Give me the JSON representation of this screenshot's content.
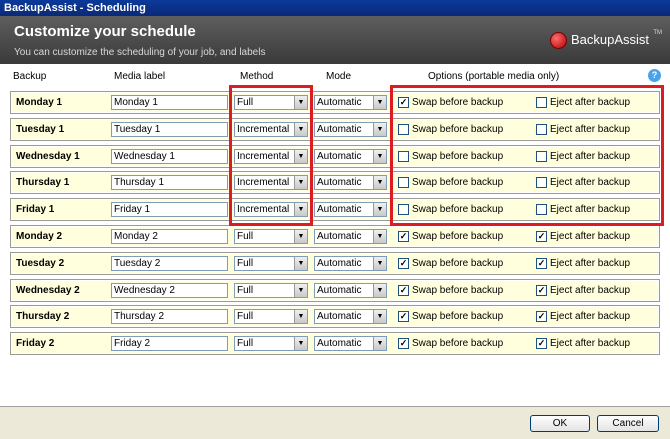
{
  "window": {
    "title": "BackupAssist - Scheduling"
  },
  "banner": {
    "title": "Customize your schedule",
    "subtitle": "You can customize the scheduling of your job, and labels",
    "logo_text": "BackupAssist",
    "logo_tm": "TM"
  },
  "columns": {
    "backup": "Backup",
    "media_label": "Media label",
    "method": "Method",
    "mode": "Mode",
    "options": "Options (portable media only)",
    "help": "?"
  },
  "options_labels": {
    "swap": "Swap before backup",
    "eject": "Eject after backup"
  },
  "rows": [
    {
      "name": "Monday 1",
      "media": "Monday 1",
      "method": "Full",
      "mode": "Automatic",
      "swap": true,
      "eject": false
    },
    {
      "name": "Tuesday 1",
      "media": "Tuesday 1",
      "method": "Incremental",
      "mode": "Automatic",
      "swap": false,
      "eject": false
    },
    {
      "name": "Wednesday 1",
      "media": "Wednesday 1",
      "method": "Incremental",
      "mode": "Automatic",
      "swap": false,
      "eject": false
    },
    {
      "name": "Thursday 1",
      "media": "Thursday 1",
      "method": "Incremental",
      "mode": "Automatic",
      "swap": false,
      "eject": false
    },
    {
      "name": "Friday 1",
      "media": "Friday 1",
      "method": "Incremental",
      "mode": "Automatic",
      "swap": false,
      "eject": false
    },
    {
      "name": "Monday 2",
      "media": "Monday 2",
      "method": "Full",
      "mode": "Automatic",
      "swap": true,
      "eject": true
    },
    {
      "name": "Tuesday 2",
      "media": "Tuesday 2",
      "method": "Full",
      "mode": "Automatic",
      "swap": true,
      "eject": true
    },
    {
      "name": "Wednesday 2",
      "media": "Wednesday 2",
      "method": "Full",
      "mode": "Automatic",
      "swap": true,
      "eject": true
    },
    {
      "name": "Thursday 2",
      "media": "Thursday 2",
      "method": "Full",
      "mode": "Automatic",
      "swap": true,
      "eject": true
    },
    {
      "name": "Friday 2",
      "media": "Friday 2",
      "method": "Full",
      "mode": "Automatic",
      "swap": true,
      "eject": true
    }
  ],
  "buttons": {
    "ok": "OK",
    "cancel": "Cancel"
  },
  "colors": {
    "highlight_box": "#dd1c22",
    "row_bg": "#ffffdd"
  }
}
